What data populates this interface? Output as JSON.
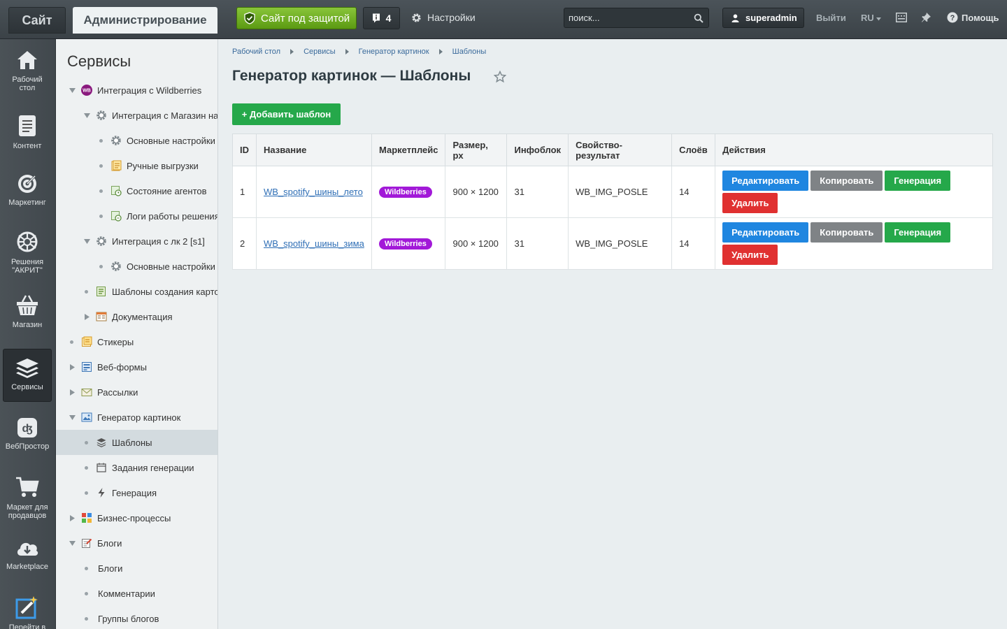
{
  "topbar": {
    "tab_site": "Сайт",
    "tab_admin": "Администрирование",
    "protection_label": "Сайт под защитой",
    "notifications_count": "4",
    "settings_label": "Настройки",
    "search_placeholder": "поиск...",
    "username": "superadmin",
    "logout_label": "Выйти",
    "language": "RU",
    "help_label": "Помощь"
  },
  "iconbar": {
    "items": [
      {
        "label_1": "Рабочий",
        "label_2": "стол",
        "icon": "home-icon"
      },
      {
        "label_1": "Контент",
        "icon": "document-icon"
      },
      {
        "label_1": "Маркетинг",
        "icon": "target-icon"
      },
      {
        "label_1": "Решения",
        "label_2": "\"АКРИТ\"",
        "icon": "knot-icon"
      },
      {
        "label_1": "Магазин",
        "icon": "basket-icon"
      },
      {
        "label_1": "Сервисы",
        "icon": "layers-icon",
        "active": true
      },
      {
        "label_1": "ВебПростор",
        "icon": "webprostor-icon"
      },
      {
        "label_1": "Маркет для",
        "label_2": "продавцов",
        "icon": "cart-icon"
      },
      {
        "label_1": "Marketplace",
        "icon": "cloud-download-icon"
      },
      {
        "label_1": "Перейти в",
        "icon": "magic-edit-icon"
      }
    ]
  },
  "tree": {
    "title": "Сервисы",
    "items": [
      {
        "label": "Интеграция с Wildberries",
        "level": 0,
        "toggle": "open",
        "icon": "wb-logo-icon"
      },
      {
        "label": "Интеграция с Магазин на",
        "level": 1,
        "toggle": "open",
        "icon": "gear-icon"
      },
      {
        "label": "Основные настройки",
        "level": 2,
        "toggle": "dot",
        "icon": "gear-icon"
      },
      {
        "label": "Ручные выгрузки",
        "level": 2,
        "toggle": "dot",
        "icon": "notes-icon"
      },
      {
        "label": "Состояние агентов",
        "level": 2,
        "toggle": "dot",
        "icon": "agent-status-icon"
      },
      {
        "label": "Логи работы решения",
        "level": 2,
        "toggle": "dot",
        "icon": "log-icon"
      },
      {
        "label": "Интеграция с лк 2 [s1]",
        "level": 1,
        "toggle": "open",
        "icon": "gear-icon"
      },
      {
        "label": "Основные настройки",
        "level": 2,
        "toggle": "dot",
        "icon": "gear-icon"
      },
      {
        "label": "Шаблоны создания карто",
        "level": 1,
        "toggle": "dot",
        "icon": "list-icon"
      },
      {
        "label": "Документация",
        "level": 1,
        "toggle": "closed",
        "icon": "doc-grid-icon"
      },
      {
        "label": "Стикеры",
        "level": 0,
        "toggle": "dot",
        "icon": "sticker-icon"
      },
      {
        "label": "Веб-формы",
        "level": 0,
        "toggle": "closed",
        "icon": "form-icon"
      },
      {
        "label": "Рассылки",
        "level": 0,
        "toggle": "closed",
        "icon": "mail-icon"
      },
      {
        "label": "Генератор картинок",
        "level": 0,
        "toggle": "open",
        "icon": "image-icon"
      },
      {
        "label": "Шаблоны",
        "level": 1,
        "toggle": "dot",
        "icon": "layers-small-icon",
        "selected": true
      },
      {
        "label": "Задания генерации",
        "level": 1,
        "toggle": "dot",
        "icon": "calendar-icon"
      },
      {
        "label": "Генерация",
        "level": 1,
        "toggle": "dot",
        "icon": "bolt-icon"
      },
      {
        "label": "Бизнес-процессы",
        "level": 0,
        "toggle": "closed",
        "icon": "bizproc-icon"
      },
      {
        "label": "Блоги",
        "level": 0,
        "toggle": "open",
        "icon": "blog-icon"
      },
      {
        "label": "Блоги",
        "level": 1,
        "toggle": "dot",
        "icon": ""
      },
      {
        "label": "Комментарии",
        "level": 1,
        "toggle": "dot",
        "icon": ""
      },
      {
        "label": "Группы блогов",
        "level": 1,
        "toggle": "dot",
        "icon": ""
      }
    ]
  },
  "main": {
    "breadcrumb": [
      "Рабочий стол",
      "Сервисы",
      "Генератор картинок",
      "Шаблоны"
    ],
    "title": "Генератор картинок — Шаблоны",
    "add_button": "+ Добавить шаблон",
    "table": {
      "headers": [
        "ID",
        "Название",
        "Маркетплейс",
        "Размер, px",
        "Инфоблок",
        "Свойство-результат",
        "Слоёв",
        "Действия"
      ],
      "rows": [
        {
          "id": "1",
          "name": "WB_spotify_шины_лето",
          "marketplace": "Wildberries",
          "size": "900 × 1200",
          "iblock": "31",
          "property": "WB_IMG_POSLE",
          "layers": "14"
        },
        {
          "id": "2",
          "name": "WB_spotify_шины_зима",
          "marketplace": "Wildberries",
          "size": "900 × 1200",
          "iblock": "31",
          "property": "WB_IMG_POSLE",
          "layers": "14"
        }
      ],
      "actions": {
        "edit": "Редактировать",
        "copy": "Копировать",
        "generate": "Генерация",
        "delete": "Удалить"
      }
    }
  },
  "colors": {
    "accent_green": "#25a84a",
    "edit_blue": "#1f86e0",
    "delete_red": "#e03131",
    "wb_purple": "#a219d8"
  }
}
